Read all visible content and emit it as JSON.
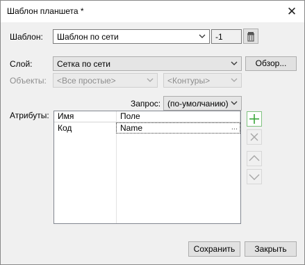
{
  "window": {
    "title": "Шаблон планшета *",
    "close_icon": "close-icon"
  },
  "template": {
    "label": "Шаблон:",
    "value": "Шаблон по сети",
    "number": "-1",
    "delete_icon": "trash-icon"
  },
  "layer": {
    "label": "Слой:",
    "value": "Сетка по сети",
    "browse_label": "Обзор..."
  },
  "objects": {
    "label": "Объекты:",
    "type_value": "<Все простые>",
    "contour_value": "<Контуры>"
  },
  "query": {
    "label": "Запрос:",
    "value": "(по-умолчанию)"
  },
  "attributes": {
    "label": "Атрибуты:",
    "columns": [
      "Имя",
      "Поле"
    ],
    "rows": [
      {
        "name": "Код",
        "field": "Name",
        "ellipsis": "..."
      }
    ]
  },
  "side_buttons": {
    "add_icon": "plus-icon",
    "remove_icon": "x-icon",
    "up_icon": "chevron-up-icon",
    "down_icon": "chevron-down-icon"
  },
  "footer": {
    "save_label": "Сохранить",
    "close_label": "Закрыть"
  },
  "colors": {
    "add_green": "#3aa63a",
    "disabled_gray": "#a6a6a6",
    "focus_blue": "#0078d7"
  }
}
